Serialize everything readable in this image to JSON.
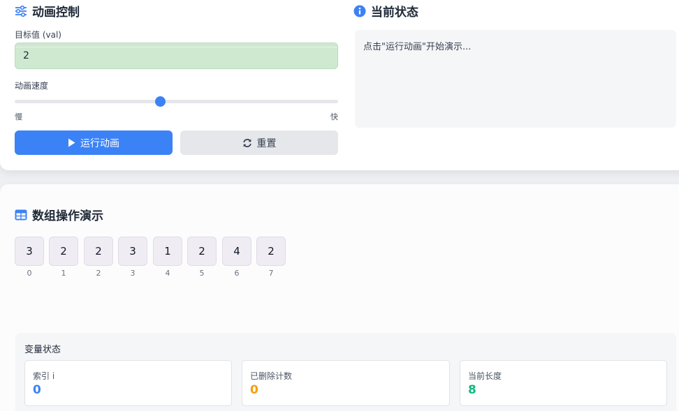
{
  "controls": {
    "title": "动画控制",
    "target_label": "目标值 (val)",
    "target_value": "2",
    "speed_label": "动画速度",
    "speed_level": 0.45,
    "speed_min_label": "慢",
    "speed_max_label": "快",
    "run_button": "运行动画",
    "reset_button": "重置"
  },
  "status": {
    "title": "当前状态",
    "message": "点击\"运行动画\"开始演示..."
  },
  "array_demo": {
    "title": "数组操作演示",
    "cells": [
      {
        "value": "3",
        "index": "0"
      },
      {
        "value": "2",
        "index": "1"
      },
      {
        "value": "2",
        "index": "2"
      },
      {
        "value": "3",
        "index": "3"
      },
      {
        "value": "1",
        "index": "4"
      },
      {
        "value": "2",
        "index": "5"
      },
      {
        "value": "4",
        "index": "6"
      },
      {
        "value": "2",
        "index": "7"
      }
    ]
  },
  "variables": {
    "title": "变量状态",
    "items": [
      {
        "label": "索引 i",
        "value": "0",
        "color": "#3b82f6"
      },
      {
        "label": "已删除计数",
        "value": "0",
        "color": "#f59e0b"
      },
      {
        "label": "当前长度",
        "value": "8",
        "color": "#10b981"
      }
    ]
  },
  "colors": {
    "accent": "#3b82f6",
    "input_bg": "#cfe8d0"
  },
  "icons": {
    "controls": "sliders-icon",
    "status": "info-circle-icon",
    "array": "table-icon",
    "run": "play-icon",
    "reset": "sync-icon"
  }
}
